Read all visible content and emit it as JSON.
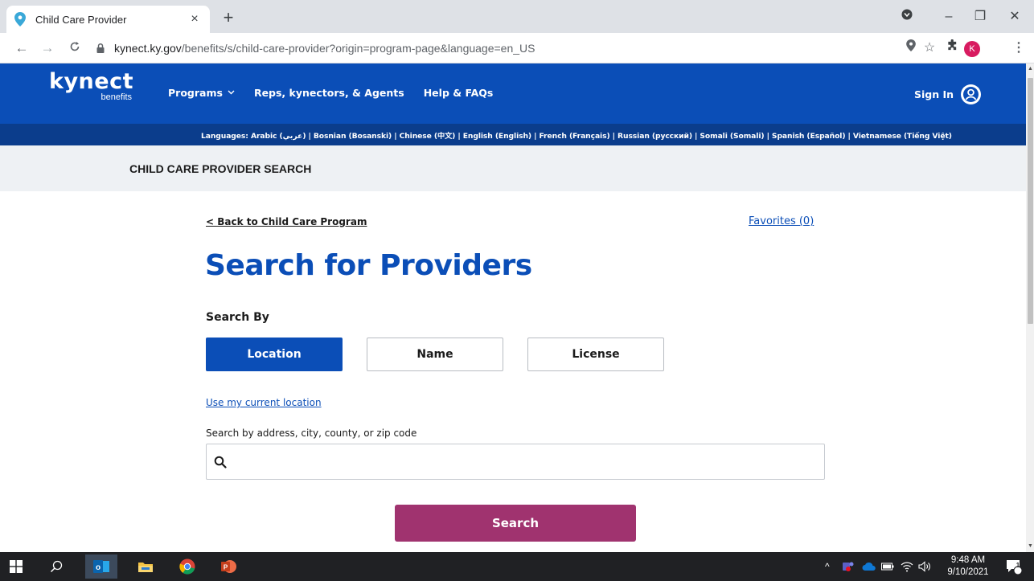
{
  "browser": {
    "tab_title": "Child Care Provider",
    "tab_close": "×",
    "new_tab": "+",
    "url_host": "kynect.ky.gov",
    "url_path": "/benefits/s/child-care-provider?origin=program-page&language=en_US",
    "profile_initial": "K",
    "window_min": "–",
    "window_restore": "❐",
    "window_close": "✕"
  },
  "site": {
    "logo_main": "kynect",
    "logo_sub": "benefits",
    "nav": {
      "programs": "Programs",
      "reps": "Reps, kynectors, & Agents",
      "help": "Help & FAQs"
    },
    "sign_in": "Sign In",
    "languages": "Languages: Arabic (عربي) | Bosnian (Bosanski) | Chinese (中文) | English (English) | French (Français) | Russian (русский) | Somali (Somali) | Spanish (Español) | Vietnamese (Tiếng Việt)"
  },
  "subheader": {
    "title": "CHILD CARE PROVIDER SEARCH"
  },
  "main": {
    "back_link": "< Back to Child Care Program",
    "favorites_link": "Favorites (0)",
    "title": "Search for Providers",
    "search_by_label": "Search By",
    "tabs": [
      {
        "label": "Location",
        "active": true
      },
      {
        "label": "Name",
        "active": false
      },
      {
        "label": "License",
        "active": false
      }
    ],
    "use_location_link": "Use my current location",
    "search_field_label": "Search by address, city, county, or zip code",
    "search_value": "",
    "search_button": "Search"
  },
  "taskbar": {
    "time": "9:48 AM",
    "date": "9/10/2021",
    "notification_count": "1"
  },
  "colors": {
    "brand_blue": "#0b4eb7",
    "lang_bar": "#0b3d8c",
    "search_button": "#a0336f",
    "subheader_bg": "#eef1f4"
  }
}
